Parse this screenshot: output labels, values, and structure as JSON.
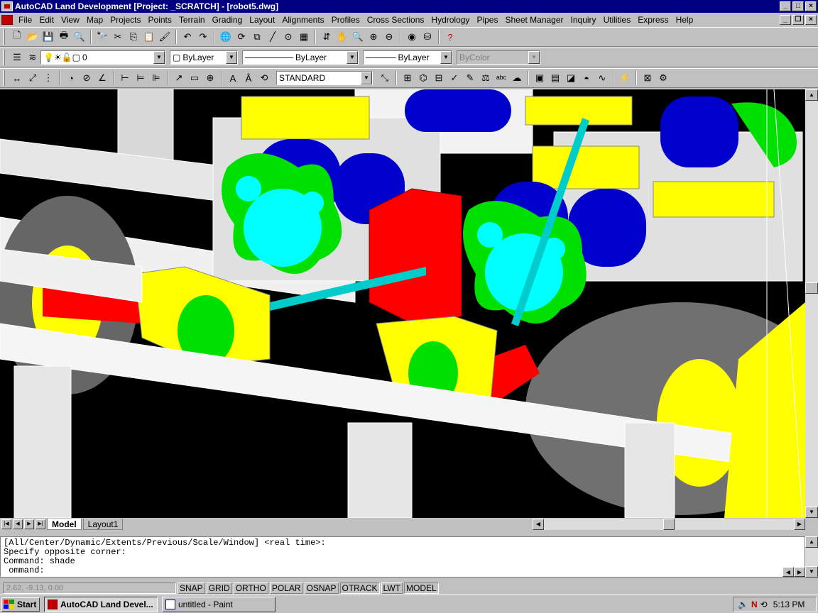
{
  "window": {
    "title": "AutoCAD Land Development [Project: _SCRATCH] - [robot5.dwg]",
    "min_label": "_",
    "max_label": "□",
    "close_label": "×",
    "restore_label": "❐"
  },
  "menu": {
    "items": [
      "File",
      "Edit",
      "View",
      "Map",
      "Projects",
      "Points",
      "Terrain",
      "Grading",
      "Layout",
      "Alignments",
      "Profiles",
      "Cross Sections",
      "Hydrology",
      "Pipes",
      "Sheet Manager",
      "Inquiry",
      "Utilities",
      "Express",
      "Help"
    ]
  },
  "standard_toolbar": {
    "icons": [
      "new-icon",
      "open-icon",
      "save-icon",
      "print-icon",
      "print-preview-icon",
      "find-icon",
      "cut-icon",
      "copy-icon",
      "paste-icon",
      "match-properties-icon",
      "undo-icon",
      "redo-icon",
      "globe-icon",
      "redraw-icon",
      "purge-icon",
      "line-tool-icon",
      "snap-icon",
      "table-icon",
      "ucs-icon",
      "pan-icon",
      "zoom-realtime-icon",
      "zoom-window-icon",
      "zoom-previous-icon",
      "3d-orbit-icon",
      "layers-icon",
      "help-icon"
    ],
    "glyphs": [
      "🗋",
      "📂",
      "💾",
      "🖶",
      "🔍",
      "🔭",
      "✂",
      "⎘",
      "📋",
      "🖌",
      "↶",
      "↷",
      "🌐",
      "⟳",
      "⧉",
      "╱",
      "⊙",
      "▦",
      "⇵",
      "✋",
      "🔍",
      "⊕",
      "⊖",
      "◉",
      "⛁",
      "?"
    ]
  },
  "layers_toolbar": {
    "layer_value": "0",
    "color_value": "ByLayer",
    "linetype_value": "ByLayer",
    "lineweight_value": "ByLayer",
    "plotstyle_value": "ByColor"
  },
  "dimension_toolbar": {
    "dimstyle_value": "STANDARD"
  },
  "viewport": {
    "background": "#000000"
  },
  "layout_tabs": [
    "Model",
    "Layout1"
  ],
  "command_history": [
    "[All/Center/Dynamic/Extents/Previous/Scale/Window] <real time>:",
    "Specify opposite corner:",
    "Command: shade",
    " ommand:"
  ],
  "status": {
    "coords": "2.62, -9.13, 0.00",
    "toggles": [
      "SNAP",
      "GRID",
      "ORTHO",
      "POLAR",
      "OSNAP",
      "OTRACK",
      "LWT",
      "MODEL"
    ]
  },
  "taskbar": {
    "start_label": "Start",
    "tasks": [
      "AutoCAD Land Devel...",
      "untitled - Paint"
    ],
    "clock": "5:13 PM"
  }
}
